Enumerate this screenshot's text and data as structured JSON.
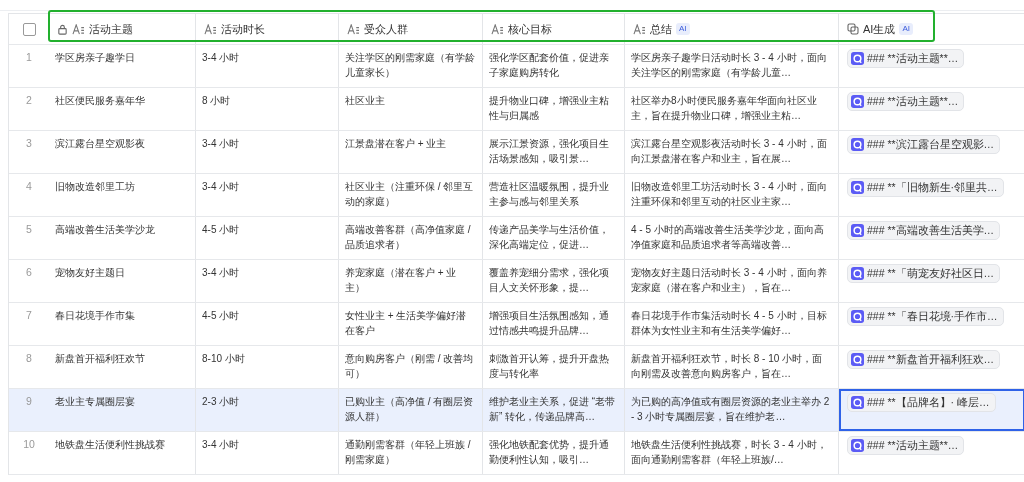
{
  "table": {
    "select_all": {
      "checked": false
    },
    "columns": [
      {
        "label": "活动主题",
        "locked": true
      },
      {
        "label": "活动时长",
        "locked": false
      },
      {
        "label": "受众人群",
        "locked": false
      },
      {
        "label": "核心目标",
        "locked": false
      },
      {
        "label": "总结",
        "locked": false,
        "badge": "AI"
      },
      {
        "label": "AI生成",
        "locked": false,
        "badge": "AI"
      }
    ],
    "rows": [
      {
        "number": "1",
        "selected": false,
        "ai_focused": false,
        "cells": [
          "学区房亲子趣学日",
          "3-4 小时",
          "关注学区的刚需家庭（有学龄儿童家长）",
          "强化学区配套价值，促进亲子家庭购房转化",
          "学区房亲子趣学日活动时长 3 - 4 小时，面向关注学区的刚需家庭（有学龄儿童…"
        ],
        "ai": "### **活动主题**…"
      },
      {
        "number": "2",
        "selected": false,
        "ai_focused": false,
        "cells": [
          "社区便民服务嘉年华",
          "8 小时",
          "社区业主",
          "提升物业口碑，增强业主粘性与归属感",
          "社区举办8小时便民服务嘉年华面向社区业主，旨在提升物业口碑，增强业主粘…"
        ],
        "ai": "### **活动主题**…"
      },
      {
        "number": "3",
        "selected": false,
        "ai_focused": false,
        "cells": [
          "滨江露台星空观影夜",
          "3-4 小时",
          "江景盘潜在客户 + 业主",
          "展示江景资源，强化项目生活场景感知，吸引景…",
          "滨江露台星空观影夜活动时长 3 - 4 小时，面向江景盘潜在客户和业主，旨在展…"
        ],
        "ai": "### **滨江露台星空观影…"
      },
      {
        "number": "4",
        "selected": false,
        "ai_focused": false,
        "cells": [
          "旧物改造邻里工坊",
          "3-4 小时",
          "社区业主（注重环保 / 邻里互动的家庭）",
          "营造社区温暖氛围，提升业主参与感与邻里关系",
          "旧物改造邻里工坊活动时长 3 - 4 小时，面向注重环保和邻里互动的社区业主家…"
        ],
        "ai": "### **「旧物新生·邻里共…"
      },
      {
        "number": "5",
        "selected": false,
        "ai_focused": false,
        "cells": [
          "高端改善生活美学沙龙",
          "4-5 小时",
          "高端改善客群（高净值家庭 / 品质追求者）",
          "传递产品美学与生活价值，深化高端定位，促进…",
          "4 - 5 小时的高端改善生活美学沙龙，面向高净值家庭和品质追求者等高端改善…"
        ],
        "ai": "### **高端改善生活美学…"
      },
      {
        "number": "6",
        "selected": false,
        "ai_focused": false,
        "cells": [
          "宠物友好主题日",
          "3-4 小时",
          "养宠家庭（潜在客户 + 业主）",
          "覆盖养宠细分需求，强化项目人文关怀形象，提…",
          "宠物友好主题日活动时长 3 - 4 小时，面向养宠家庭（潜在客户和业主），旨在…"
        ],
        "ai": "### **「萌宠友好社区日…"
      },
      {
        "number": "7",
        "selected": false,
        "ai_focused": false,
        "cells": [
          "春日花境手作市集",
          "4-5 小时",
          "女性业主 + 生活美学偏好潜在客户",
          "增强项目生活氛围感知，通过情感共鸣提升品牌…",
          "春日花境手作市集活动时长 4 - 5 小时，目标群体为女性业主和有生活美学偏好…"
        ],
        "ai": "### **「春日花境·手作市…"
      },
      {
        "number": "8",
        "selected": false,
        "ai_focused": false,
        "cells": [
          "新盘首开福利狂欢节",
          "8-10 小时",
          "意向购房客户（刚需 / 改善均可）",
          "刺激首开认筹，提升开盘热度与转化率",
          "新盘首开福利狂欢节，时长 8 - 10 小时，面向刚需及改善意向购房客户，旨在…"
        ],
        "ai": "### **新盘首开福利狂欢…"
      },
      {
        "number": "9",
        "selected": true,
        "ai_focused": true,
        "cells": [
          "老业主专属圈层宴",
          "2-3 小时",
          "已购业主（高净值 / 有圈层资源人群）",
          "维护老业主关系，促进 “老带新” 转化，传递品牌高…",
          "为已购的高净值或有圈层资源的老业主举办 2 - 3 小时专属圈层宴，旨在维护老…"
        ],
        "ai": "### **【品牌名】· 峰层…"
      },
      {
        "number": "10",
        "selected": false,
        "ai_focused": false,
        "cells": [
          "地铁盘生活便利性挑战赛",
          "3-4 小时",
          "通勤刚需客群（年轻上班族 / 刚需家庭）",
          "强化地铁配套优势，提升通勤便利性认知，吸引…",
          "地铁盘生活便利性挑战赛，时长 3 - 4 小时，面向通勤刚需客群（年轻上班族/…"
        ],
        "ai": "### **活动主题**…"
      }
    ]
  }
}
